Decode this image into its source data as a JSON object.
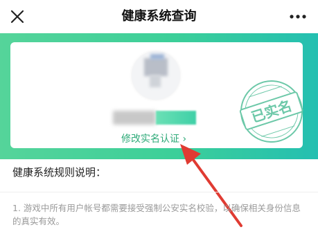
{
  "header": {
    "title": "健康系统查询",
    "close_icon": "close-icon",
    "more_icon": "more-icon"
  },
  "card": {
    "stamp_text": "已实名",
    "modify_link": "修改实名认证 ›"
  },
  "rules": {
    "title": "健康系统规则说明：",
    "items": [
      "1. 游戏中所有用户帐号都需要接受强制公安实名校验，以确保相关身份信息的真实有效。"
    ]
  },
  "colors": {
    "banner_start": "#55d49a",
    "banner_end": "#24bfb1",
    "link": "#2eaa78",
    "stamp": "#6cc8a8",
    "arrow": "#e03b32"
  }
}
